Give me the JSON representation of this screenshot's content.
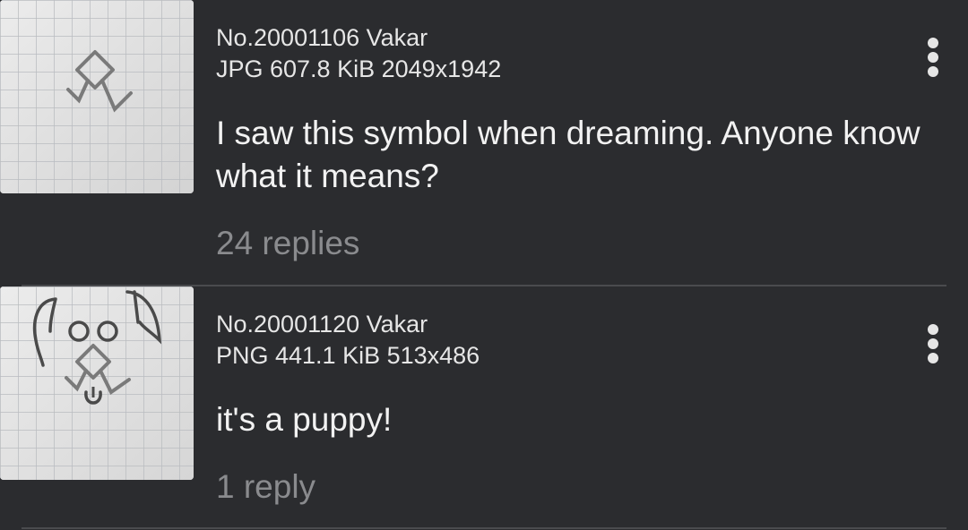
{
  "posts": [
    {
      "meta_line1": "No.20001106 Vakar",
      "meta_line2": "JPG 607.8 KiB 2049x1942",
      "comment": "I saw this symbol when dreaming. Anyone know what it means?",
      "replies": "24 replies",
      "thumbnail_icon": "symbol-sketch-thumbnail",
      "menu_icon": "more-vertical-icon"
    },
    {
      "meta_line1": "No.20001120 Vakar",
      "meta_line2": "PNG 441.1 KiB 513x486",
      "comment": "it's a puppy!",
      "replies": "1 reply",
      "thumbnail_icon": "puppy-sketch-thumbnail",
      "menu_icon": "more-vertical-icon"
    }
  ],
  "colors": {
    "background": "#2b2c2f",
    "text": "#f2f2f2",
    "meta_text": "#e6e6e6",
    "replies_text": "#8a8b8e",
    "divider": "#4a4b4e"
  }
}
